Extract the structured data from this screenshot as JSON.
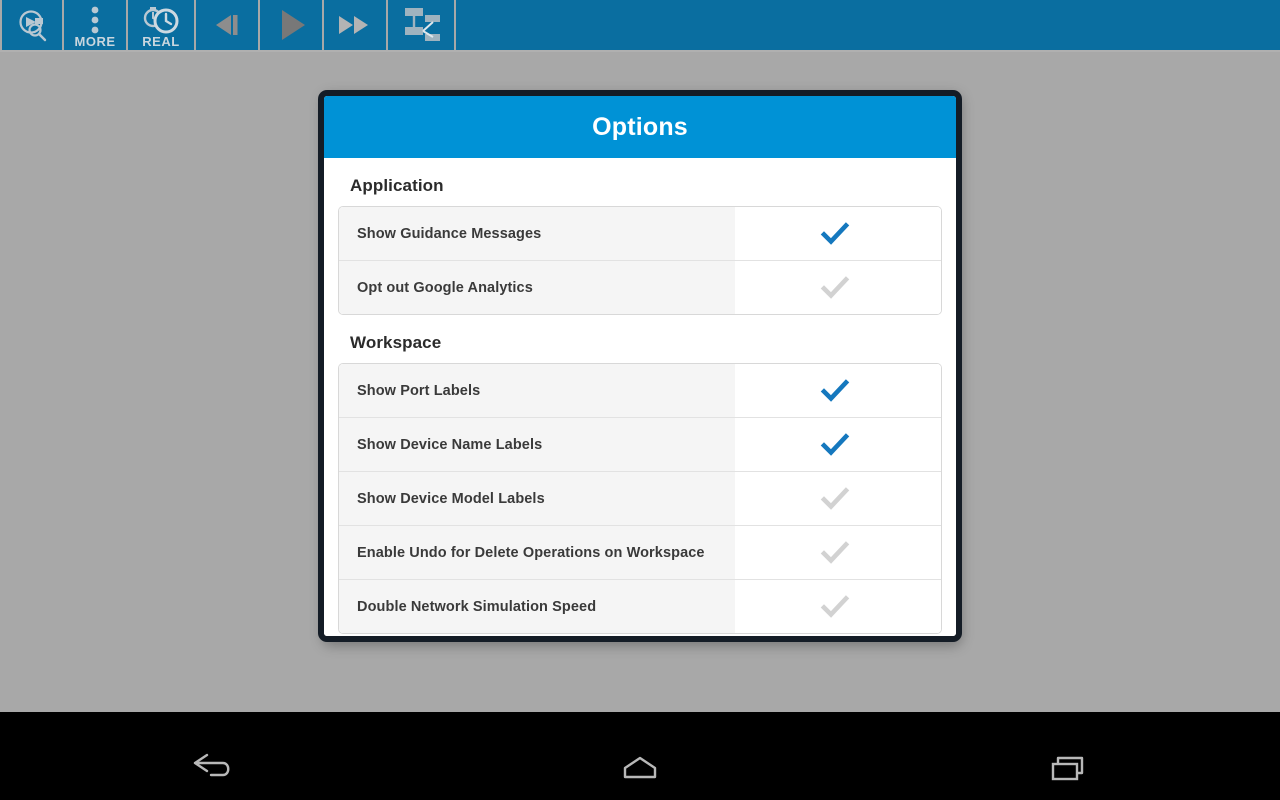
{
  "toolbar": {
    "buttons": [
      {
        "name": "inspect-tool",
        "icon": "magnifier-inspect-icon",
        "label": ""
      },
      {
        "name": "more-tools",
        "icon": "vertical-dots-icon",
        "label": "MORE"
      },
      {
        "name": "realtime-mode",
        "icon": "stopwatch-clock-icon",
        "label": "REAL"
      },
      {
        "name": "step-back",
        "icon": "step-back-icon",
        "label": ""
      },
      {
        "name": "play",
        "icon": "play-icon",
        "label": ""
      },
      {
        "name": "fast-forward",
        "icon": "fast-forward-icon",
        "label": ""
      },
      {
        "name": "network-topology",
        "icon": "network-topology-icon",
        "label": ""
      }
    ]
  },
  "dialog": {
    "title": "Options",
    "sections": [
      {
        "title": "Application",
        "rows": [
          {
            "label": "Show Guidance Messages",
            "checked": true
          },
          {
            "label": "Opt out Google Analytics",
            "checked": false
          }
        ]
      },
      {
        "title": "Workspace",
        "rows": [
          {
            "label": "Show Port Labels",
            "checked": true
          },
          {
            "label": "Show Device Name Labels",
            "checked": true
          },
          {
            "label": "Show Device Model Labels",
            "checked": false
          },
          {
            "label": "Enable Undo for Delete Operations on Workspace",
            "checked": false
          },
          {
            "label": "Double Network Simulation Speed",
            "checked": false
          }
        ]
      }
    ]
  },
  "navbar": {
    "buttons": [
      {
        "name": "nav-back",
        "icon": "back-arrow-icon"
      },
      {
        "name": "nav-home",
        "icon": "home-icon"
      },
      {
        "name": "nav-recents",
        "icon": "recents-icon"
      }
    ]
  },
  "colors": {
    "toolbar_blue": "#0a6ea0",
    "title_blue": "#0092d6",
    "check_on": "#1578be",
    "check_off": "#d2d2d2",
    "background_gray": "#a8a8a8",
    "row_label_gray": "#f5f5f5"
  }
}
